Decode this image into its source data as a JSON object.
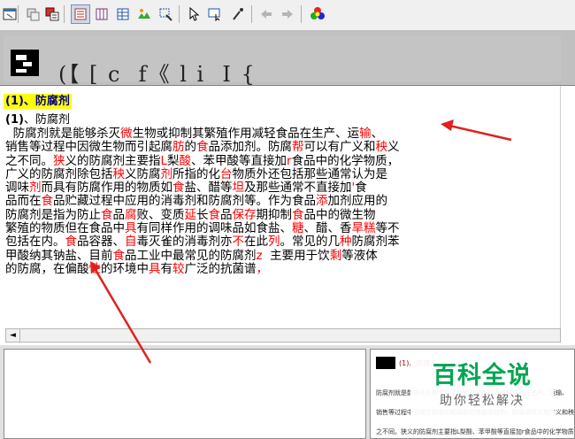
{
  "toolbar": {
    "icons": [
      "window-icon",
      "copy-icon",
      "paste-icon",
      "view-text-icon",
      "view-columns-icon",
      "table-icon",
      "image-icon",
      "crop-select-icon",
      "pointer-icon",
      "zoom-region-icon",
      "eyedropper-icon",
      "back-arrow-icon",
      "forward-arrow-icon",
      "color-palette-icon"
    ]
  },
  "glyph_strip": {
    "glyphs": "(【 [ c  f《 l i  I {"
  },
  "document": {
    "heading": "(1)、防腐剂",
    "subheading_paren": "(1)",
    "subheading_text": "、防腐剂",
    "lines": [
      [
        [
          "  防腐剂就是能够杀灭",
          ""
        ],
        [
          "微",
          "red"
        ],
        [
          "生物或抑制其繁殖作用减轻食品在生产、运",
          ""
        ],
        [
          "输",
          "red"
        ],
        [
          "、",
          ""
        ]
      ],
      [
        [
          "销售等过程中因微生物而引起腐",
          ""
        ],
        [
          "肪",
          "red"
        ],
        [
          "的",
          ""
        ],
        [
          "食",
          "red"
        ],
        [
          "品添加剂。防腐",
          ""
        ],
        [
          "帮",
          "red"
        ],
        [
          "可以有广义和",
          ""
        ],
        [
          "秧",
          "red"
        ],
        [
          "义",
          ""
        ]
      ],
      [
        [
          "之不同。",
          ""
        ],
        [
          "狭",
          "red"
        ],
        [
          "义的防腐剂主要指",
          ""
        ],
        [
          "L",
          "red"
        ],
        [
          "梨",
          ""
        ],
        [
          "酸",
          "red"
        ],
        [
          "、苯甲酸等直接加",
          ""
        ],
        [
          "r",
          "red"
        ],
        [
          "食品中的化学物质，",
          ""
        ]
      ],
      [
        [
          "广义的防腐剂除包括",
          ""
        ],
        [
          "秧",
          "red"
        ],
        [
          "义防腐",
          ""
        ],
        [
          "剂",
          "red"
        ],
        [
          "所指的化",
          ""
        ],
        [
          "台",
          "red"
        ],
        [
          "物质外还包括那些通常认为是",
          ""
        ]
      ],
      [
        [
          "调味",
          ""
        ],
        [
          "剂",
          "red"
        ],
        [
          "而具有防腐作用的物质如",
          ""
        ],
        [
          "食",
          "red"
        ],
        [
          "盐、醋等",
          ""
        ],
        [
          "坦",
          "red"
        ],
        [
          "及那些通常不直接加",
          ""
        ],
        [
          "'",
          "red"
        ],
        [
          "食",
          ""
        ]
      ],
      [
        [
          "品而在",
          ""
        ],
        [
          "食",
          "red"
        ],
        [
          "品贮藏过程中应用的消毒剂和防腐剂等。作为食品",
          ""
        ],
        [
          "添",
          "red"
        ],
        [
          "加剂应用的",
          ""
        ]
      ],
      [
        [
          "防腐剂是指为防止",
          ""
        ],
        [
          "食",
          "red"
        ],
        [
          "品",
          ""
        ],
        [
          "腐",
          "red"
        ],
        [
          "败、变质",
          ""
        ],
        [
          "延",
          "red"
        ],
        [
          "长",
          ""
        ],
        [
          "食",
          "red"
        ],
        [
          "品",
          ""
        ],
        [
          "保存",
          "red"
        ],
        [
          "期抑制",
          ""
        ],
        [
          "食",
          "red"
        ],
        [
          "品中的微生物",
          ""
        ]
      ],
      [
        [
          "繁殖的物质但在食品中",
          ""
        ],
        [
          "具",
          "red"
        ],
        [
          "有同样作用的调味品如食盐、",
          ""
        ],
        [
          "糖",
          "red"
        ],
        [
          "、醋、香",
          ""
        ],
        [
          "旱糕",
          "red"
        ],
        [
          "等不",
          ""
        ]
      ],
      [
        [
          "包括在内。",
          ""
        ],
        [
          "食",
          "red"
        ],
        [
          "品容器、",
          ""
        ],
        [
          "自",
          "red"
        ],
        [
          "毒灭雀的消毒剂亦",
          ""
        ],
        [
          "不",
          "red"
        ],
        [
          "在此",
          ""
        ],
        [
          "列",
          "red"
        ],
        [
          "。常见的几",
          ""
        ],
        [
          "种",
          "red"
        ],
        [
          "防腐剂苯",
          ""
        ]
      ],
      [
        [
          "甲酸纳其钠盐、目前",
          ""
        ],
        [
          "食",
          "red"
        ],
        [
          "品工业中最常见的防腐剂",
          ""
        ],
        [
          "z",
          "red"
        ],
        [
          "  主要用于饮",
          ""
        ],
        [
          "剩",
          "red"
        ],
        [
          "等液体",
          ""
        ]
      ],
      [
        [
          "的防腐，在偏酸",
          ""
        ],
        [
          "性",
          "red"
        ],
        [
          "的环境中",
          ""
        ],
        [
          "具",
          "red"
        ],
        [
          "有",
          ""
        ],
        [
          "较",
          "red"
        ],
        [
          "广泛的抗菌谱",
          ""
        ],
        [
          "，",
          "red"
        ]
      ]
    ]
  },
  "bottom_preview": {
    "lines": [
      "(1)、防腐剂",
      "防腐剂就是能够杀灭微生物或抑制其繁殖作用减轻食品在生产、运输、",
      "销售等过程中因微生物而引起腐肪的食品添加剂。防腐帮可以有广义和秧义",
      "之不同。狭义的防腐剂主要指L梨酸、苯甲酸等直接加r食品中的化学物质"
    ]
  },
  "watermark": {
    "title": "百科全说",
    "subtitle": "助你轻松解决"
  },
  "colors": {
    "highlight": "#ffff00",
    "heading_text": "#00008b",
    "error_text": "#ff0000",
    "arrow": "#e02020",
    "watermark_green": "#00a651"
  }
}
